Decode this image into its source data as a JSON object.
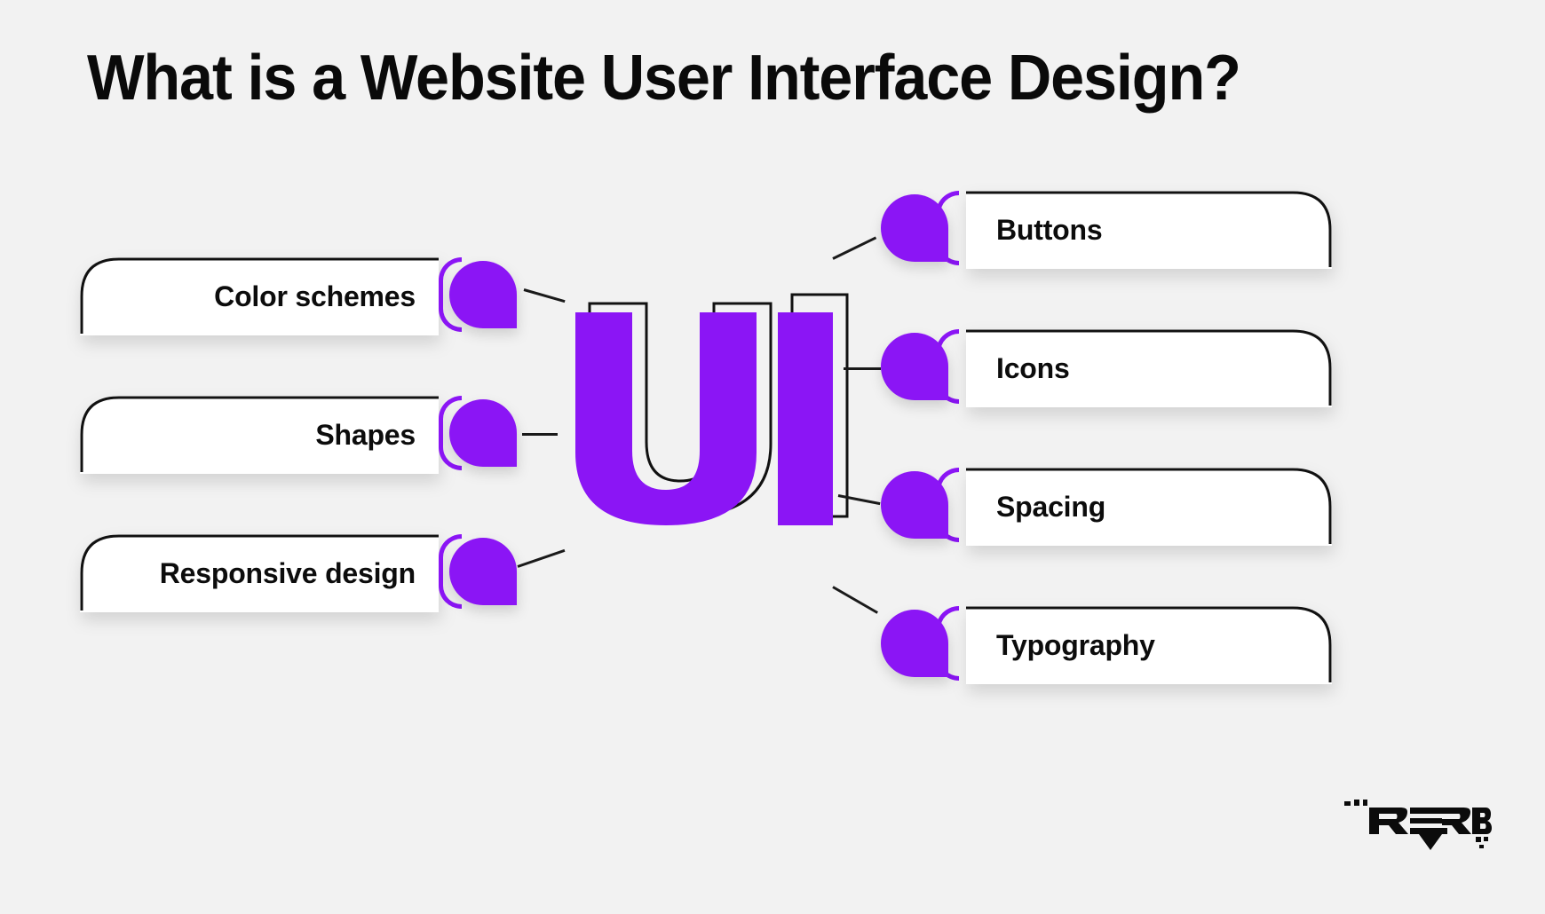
{
  "theme": {
    "background": "#f2f2f2",
    "accent_purple": "#8b15f5",
    "card_bg": "#ffffff",
    "outline": "#111111",
    "text": "#0c0c0c"
  },
  "header": {
    "title": "What is a Website User Interface Design?"
  },
  "center": {
    "mark_text": "UI",
    "mark_color": "#8b15f5",
    "outline_color": "#111111"
  },
  "left_items": [
    {
      "label": "Color schemes",
      "icon": "bubble-marker-icon"
    },
    {
      "label": "Shapes",
      "icon": "bubble-marker-icon"
    },
    {
      "label": "Responsive design",
      "icon": "bubble-marker-icon"
    }
  ],
  "right_items": [
    {
      "label": "Buttons",
      "icon": "bubble-marker-icon"
    },
    {
      "label": "Icons",
      "icon": "bubble-marker-icon"
    },
    {
      "label": "Spacing",
      "icon": "bubble-marker-icon"
    },
    {
      "label": "Typography",
      "icon": "bubble-marker-icon"
    }
  ],
  "footer": {
    "logo_text": "REVERB",
    "logo_name": "reverb-logo"
  }
}
